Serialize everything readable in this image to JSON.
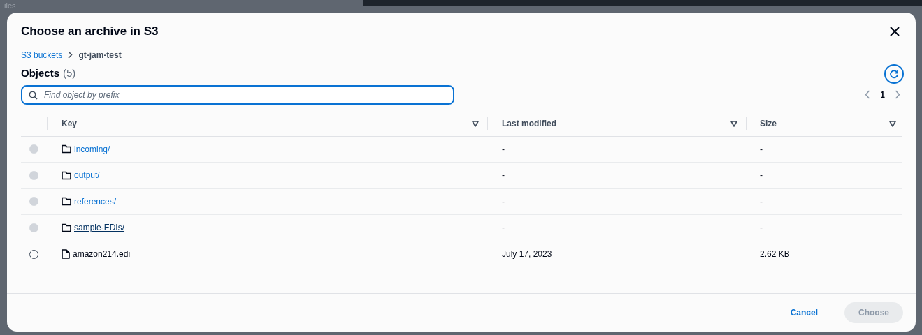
{
  "backdrop": {
    "text": "iles"
  },
  "dialog": {
    "title": "Choose an archive in S3",
    "breadcrumbs": [
      {
        "label": "S3 buckets",
        "kind": "link"
      },
      {
        "label": "gt-jam-test",
        "kind": "current"
      }
    ],
    "heading": "Objects",
    "count": "(5)",
    "search": {
      "placeholder": "Find object by prefix"
    },
    "pagination": {
      "page": "1"
    },
    "table": {
      "columns": [
        "Key",
        "Last modified",
        "Size"
      ],
      "rows": [
        {
          "kind": "folder",
          "key": "incoming/",
          "modified": "-",
          "size": "-",
          "disabled": true,
          "selected": false,
          "hovered": false
        },
        {
          "kind": "folder",
          "key": "output/",
          "modified": "-",
          "size": "-",
          "disabled": true,
          "selected": false,
          "hovered": false
        },
        {
          "kind": "folder",
          "key": "references/",
          "modified": "-",
          "size": "-",
          "disabled": true,
          "selected": false,
          "hovered": false
        },
        {
          "kind": "folder",
          "key": "sample-EDIs/",
          "modified": "-",
          "size": "-",
          "disabled": true,
          "selected": false,
          "hovered": true
        },
        {
          "kind": "file",
          "key": "amazon214.edi",
          "modified": "July 17, 2023",
          "size": "2.62 KB",
          "disabled": false,
          "selected": false,
          "hovered": false
        }
      ]
    },
    "buttons": [
      {
        "label": "Cancel",
        "kind": "link",
        "disabled": false
      },
      {
        "label": "Choose",
        "kind": "primary",
        "disabled": true
      }
    ]
  }
}
